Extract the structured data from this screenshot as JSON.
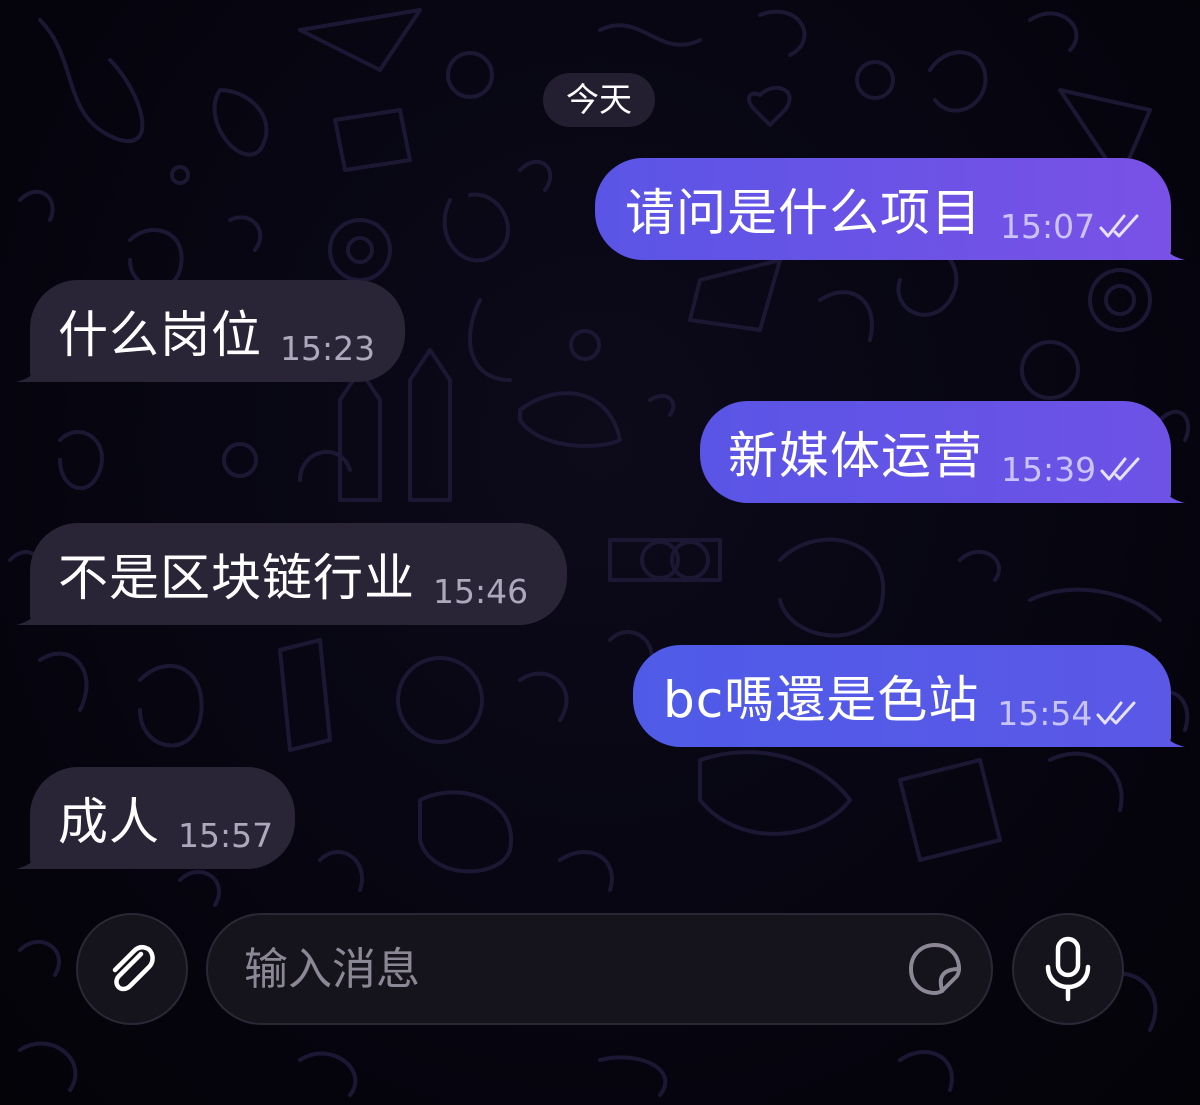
{
  "date_separator": "今天",
  "messages": [
    {
      "direction": "out",
      "text": "请问是什么项目",
      "time": "15:07",
      "read": true
    },
    {
      "direction": "in",
      "text": "什么岗位",
      "time": "15:23"
    },
    {
      "direction": "out",
      "text": "新媒体运营",
      "time": "15:39",
      "read": true
    },
    {
      "direction": "in",
      "text": "不是区块链行业",
      "time": "15:46"
    },
    {
      "direction": "out",
      "text": "bc嗎還是色站",
      "time": "15:54",
      "read": true
    },
    {
      "direction": "in",
      "text": "成人",
      "time": "15:57"
    }
  ],
  "composer": {
    "placeholder": "输入消息",
    "attach_icon": "paperclip-icon",
    "sticker_icon": "sticker-icon",
    "mic_icon": "microphone-icon"
  },
  "colors": {
    "background": "#050409",
    "incoming_bubble": "#2a2437",
    "outgoing_gradient_start": "#5b55e8",
    "outgoing_gradient_end": "#7a52e6",
    "wallpaper_doodle": "#1c1733"
  }
}
